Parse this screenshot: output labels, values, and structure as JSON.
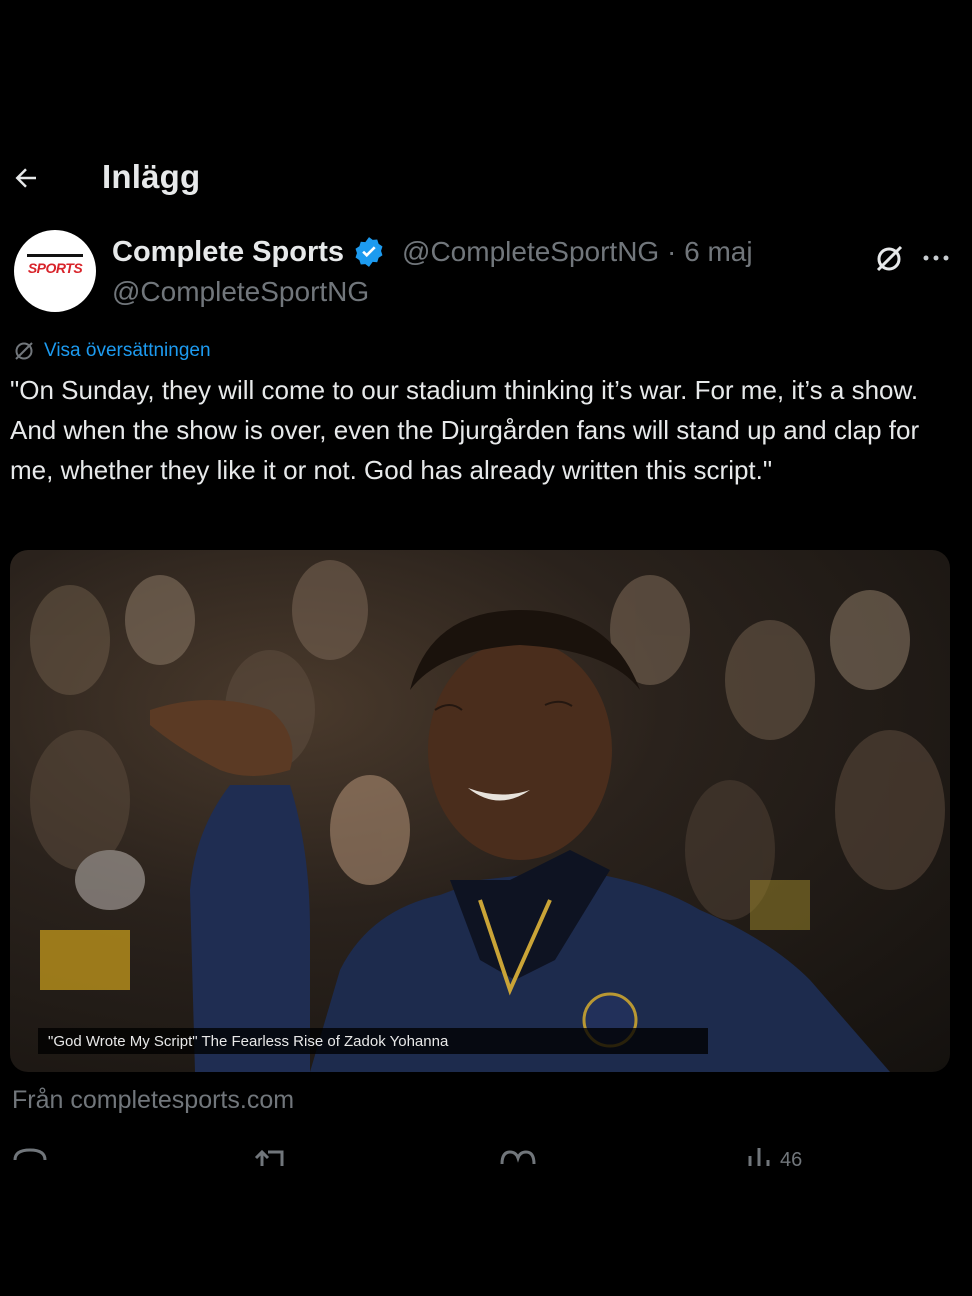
{
  "header": {
    "title": "Inlägg",
    "back_icon": "arrow-left-icon"
  },
  "post": {
    "author": {
      "display_name": "Complete Sports",
      "avatar_text": "SPORTS",
      "verified": true,
      "handle": "@CompleteSportNG",
      "handle_time": "@CompleteSportNG · 6 maj"
    },
    "translate_label": "Visa översättningen",
    "text": "\"On Sunday, they will come to our stadium thinking it’s war. For me, it’s a show. And when the show is over, even the Djurgården fans will stand up and clap for me, whether they like it or not. God has already written this script.\"",
    "card": {
      "caption": "\"God Wrote My Script\" The Fearless Rise of Zadok Yohanna",
      "source": "Från completesports.com"
    },
    "actions": {
      "views_count": "46"
    }
  },
  "colors": {
    "background": "#000000",
    "text": "#e7e9ea",
    "muted": "#71767b",
    "accent": "#1d9bf0",
    "brand_red": "#d8232a"
  }
}
